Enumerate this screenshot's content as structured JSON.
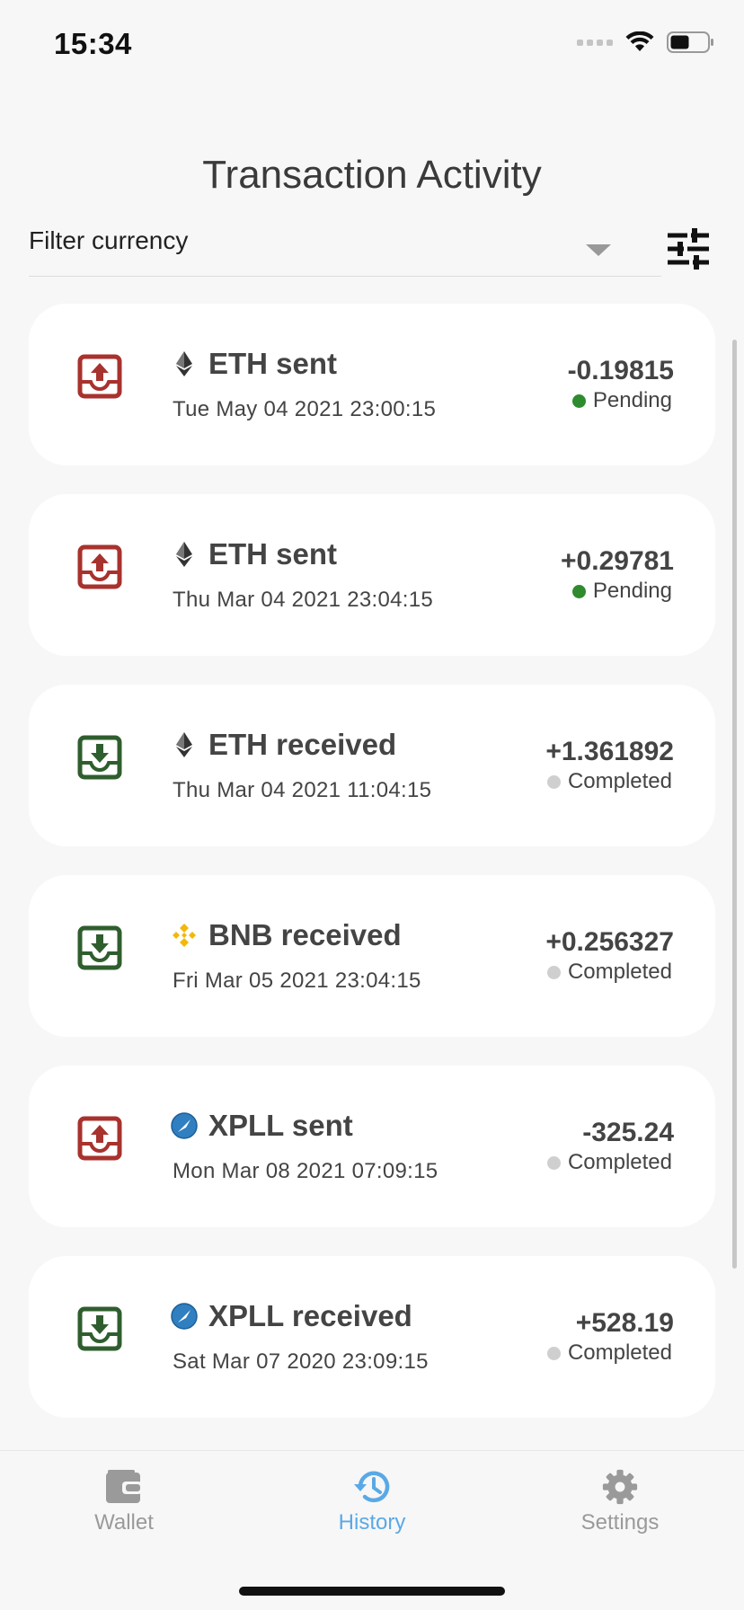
{
  "status_bar": {
    "time": "15:34",
    "icons": [
      "signal-icon",
      "wifi-icon",
      "battery-icon"
    ]
  },
  "header": {
    "title": "Transaction Activity"
  },
  "filter": {
    "label": "Filter currency",
    "icons": [
      "chevron-down-icon",
      "sliders-icon"
    ]
  },
  "colors": {
    "sent": "#a8322d",
    "received": "#2f5e2e",
    "pending": "#2e8b2e",
    "completed": "#cfcfcf",
    "active_tab": "#5aa9e6",
    "inactive_tab": "#9a9a9a",
    "bnb": "#f0b90b"
  },
  "transactions": [
    {
      "direction": "sent",
      "coin_icon": "eth-icon",
      "title": "ETH sent",
      "date": "Tue May 04 2021 23:00:15",
      "amount": "-0.19815",
      "status": "Pending"
    },
    {
      "direction": "sent",
      "coin_icon": "eth-icon",
      "title": "ETH sent",
      "date": "Thu Mar 04 2021 23:04:15",
      "amount": "+0.29781",
      "status": "Pending"
    },
    {
      "direction": "received",
      "coin_icon": "eth-icon",
      "title": "ETH received",
      "date": "Thu Mar 04 2021 11:04:15",
      "amount": "+1.361892",
      "status": "Completed"
    },
    {
      "direction": "received",
      "coin_icon": "bnb-icon",
      "title": "BNB received",
      "date": "Fri Mar 05 2021 23:04:15",
      "amount": "+0.256327",
      "status": "Completed"
    },
    {
      "direction": "sent",
      "coin_icon": "xpll-icon",
      "title": "XPLL sent",
      "date": "Mon Mar 08 2021 07:09:15",
      "amount": "-325.24",
      "status": "Completed"
    },
    {
      "direction": "received",
      "coin_icon": "xpll-icon",
      "title": "XPLL received",
      "date": "Sat Mar 07 2020 23:09:15",
      "amount": "+528.19",
      "status": "Completed"
    }
  ],
  "tabs": [
    {
      "label": "Wallet",
      "icon": "wallet-icon",
      "active": false
    },
    {
      "label": "History",
      "icon": "history-icon",
      "active": true
    },
    {
      "label": "Settings",
      "icon": "gear-icon",
      "active": false
    }
  ]
}
